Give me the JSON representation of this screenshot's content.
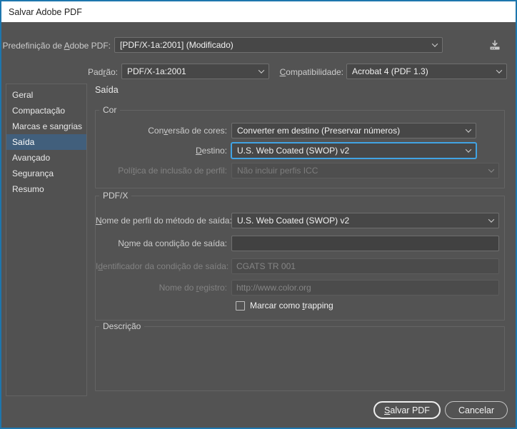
{
  "window": {
    "title": "Salvar Adobe PDF"
  },
  "colors": {
    "window_border": "#1d76ad",
    "dialog_background": "#535353",
    "sidebar_selection": "#415f7c",
    "focus_ring": "#41a3e3"
  },
  "header": {
    "preset": {
      "label_pre": "Predefinição de ",
      "label_key": "A",
      "label_post": "dobe PDF:",
      "value": "[PDF/X-1a:2001] (Modificado)"
    },
    "standard": {
      "label_pre": "Pad",
      "label_key": "r",
      "label_post": "ão:",
      "value": "PDF/X-1a:2001"
    },
    "compatibility": {
      "label_pre": "",
      "label_key": "C",
      "label_post": "ompatibilidade:",
      "value": "Acrobat 4 (PDF 1.3)"
    },
    "download_icon": "download-icon"
  },
  "sidebar": {
    "items": [
      {
        "label": "Geral",
        "selected": false
      },
      {
        "label": "Compactação",
        "selected": false
      },
      {
        "label": "Marcas e sangrias",
        "selected": false
      },
      {
        "label": "Saída",
        "selected": true
      },
      {
        "label": "Avançado",
        "selected": false
      },
      {
        "label": "Segurança",
        "selected": false
      },
      {
        "label": "Resumo",
        "selected": false
      }
    ]
  },
  "panel": {
    "title": "Saída",
    "color_group": {
      "legend": "Cor",
      "conversion": {
        "label_pre": "Con",
        "label_key": "v",
        "label_post": "ersão de cores:",
        "value": "Converter em destino (Preservar números)"
      },
      "destination": {
        "label_pre": "",
        "label_key": "D",
        "label_post": "estino:",
        "value": "U.S. Web Coated (SWOP) v2",
        "focused": true
      },
      "policy": {
        "label_pre": "Polí",
        "label_key": "t",
        "label_post": "ica de inclusão de perfil:",
        "value": "Não incluir perfis ICC",
        "disabled": true
      }
    },
    "pdfx_group": {
      "legend": "PDF/X",
      "intent_profile": {
        "label_pre": "",
        "label_key": "N",
        "label_post": "ome de perfil do método de saída:",
        "value": "U.S. Web Coated (SWOP) v2"
      },
      "condition_name": {
        "label_pre": "N",
        "label_key": "o",
        "label_post": "me da condição de saída:",
        "value": ""
      },
      "condition_id": {
        "label_pre": "I",
        "label_key": "d",
        "label_post": "entificador da condição de saída:",
        "value": "CGATS TR 001",
        "disabled": true
      },
      "registry": {
        "label_pre": "Nome do ",
        "label_key": "r",
        "label_post": "egistro:",
        "value": "http://www.color.org",
        "disabled": true
      },
      "trapping": {
        "label_pre": "Marcar como ",
        "label_key": "t",
        "label_post": "rapping",
        "checked": false
      }
    },
    "description_group": {
      "legend": "Descrição",
      "content": ""
    }
  },
  "footer": {
    "save_button": {
      "label_pre": "",
      "label_key": "S",
      "label_post": "alvar PDF"
    },
    "cancel_button": {
      "label": "Cancelar"
    }
  }
}
